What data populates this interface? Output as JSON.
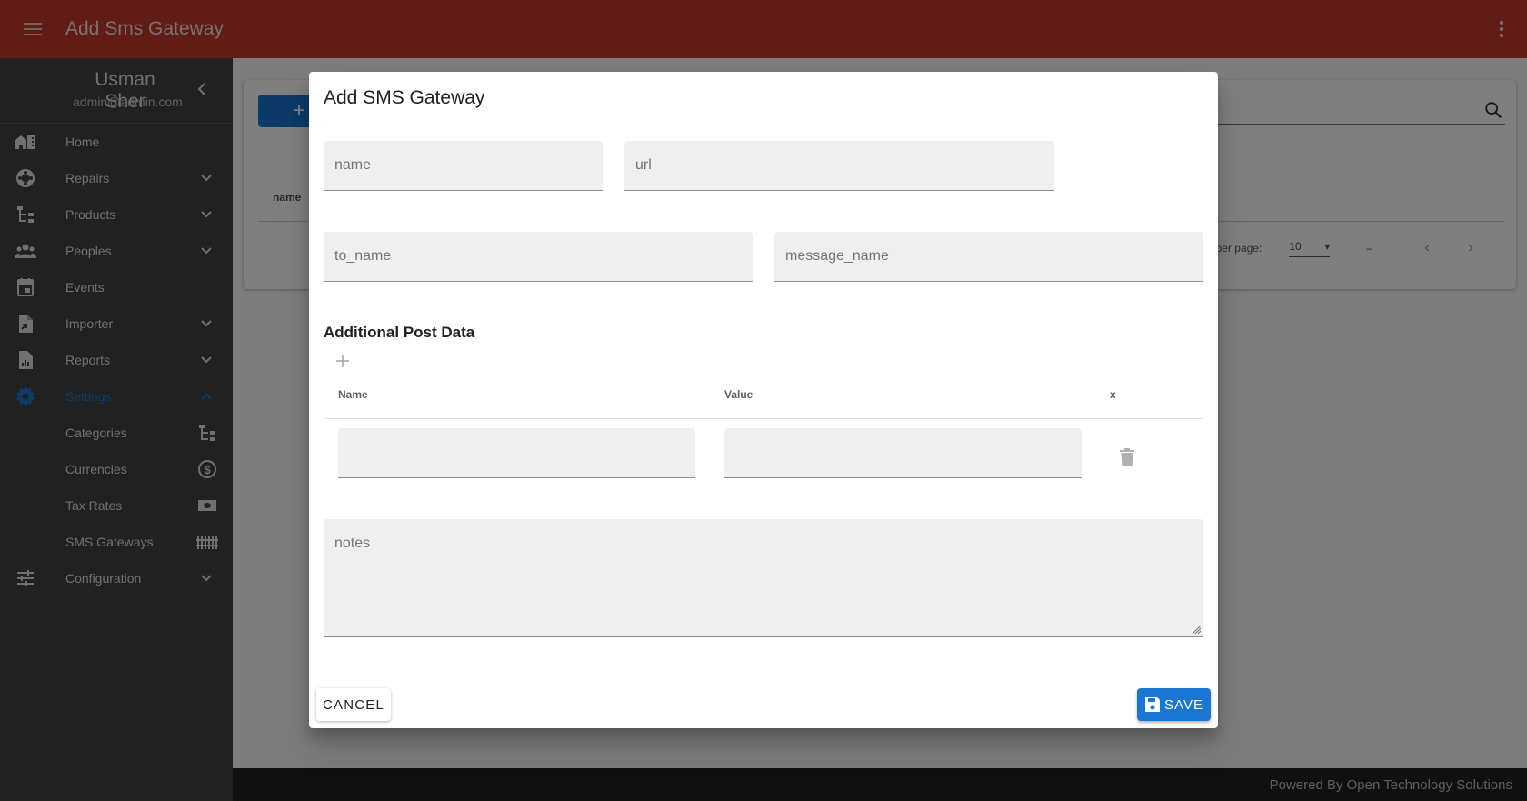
{
  "appbar": {
    "title": "Add Sms Gateway",
    "menu_icon": "hamburger-menu-icon",
    "more_icon": "more-vert-icon",
    "color": "#c0392b"
  },
  "sidebar": {
    "user_name": "Usman Sher",
    "user_email": "admin@admin.com",
    "items": [
      {
        "label": "Home",
        "icon": "home-icon",
        "expandable": false
      },
      {
        "label": "Repairs",
        "icon": "lifebuoy-icon",
        "expandable": true
      },
      {
        "label": "Products",
        "icon": "tree-structure-icon",
        "expandable": true
      },
      {
        "label": "Peoples",
        "icon": "people-icon",
        "expandable": true
      },
      {
        "label": "Events",
        "icon": "calendar-icon",
        "expandable": false
      },
      {
        "label": "Importer",
        "icon": "file-import-icon",
        "expandable": true
      },
      {
        "label": "Reports",
        "icon": "report-icon",
        "expandable": true
      },
      {
        "label": "Settings",
        "icon": "gear-icon",
        "expandable": true,
        "active": true,
        "expanded": true
      },
      {
        "label": "Configuration",
        "icon": "tune-icon",
        "expandable": true
      }
    ],
    "settings_children": [
      {
        "label": "Categories",
        "icon": "tree-structure-icon"
      },
      {
        "label": "Currencies",
        "icon": "dollar-circle-icon"
      },
      {
        "label": "Tax Rates",
        "icon": "money-icon"
      },
      {
        "label": "SMS Gateways",
        "icon": "fence-icon"
      }
    ],
    "active_color": "#1976d2"
  },
  "background_table": {
    "add_button": "+",
    "column_header": "name",
    "rows_per_page_label": "Rows per page:",
    "rows_per_page_value": "10",
    "range_text": "–"
  },
  "dialog": {
    "title": "Add SMS Gateway",
    "fields": {
      "name_placeholder": "name",
      "url_placeholder": "url",
      "to_name_placeholder": "to_name",
      "message_name_placeholder": "message_name",
      "notes_placeholder": "notes"
    },
    "additional_post_data": {
      "title": "Additional Post Data",
      "columns": [
        "Name",
        "Value",
        "x"
      ],
      "rows": [
        {
          "name": "",
          "value": ""
        }
      ]
    },
    "cancel_label": "CANCEL",
    "save_label": "SAVE"
  },
  "footer": {
    "text": "Powered By Open Technology Solutions"
  }
}
